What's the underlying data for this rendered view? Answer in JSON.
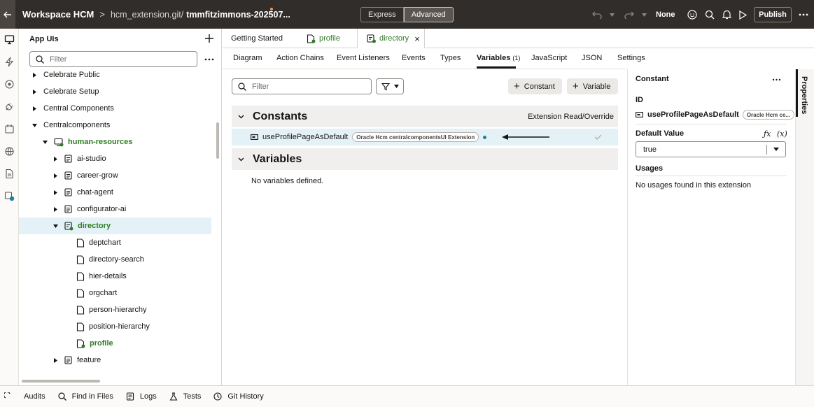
{
  "header": {
    "app_title": "Workspace HCM",
    "breadcrumb_sep": ">",
    "path": "hcm_extension.git/",
    "repo": "tmmfitzimmons-202507...",
    "modes": [
      "Express",
      "Advanced"
    ],
    "active_mode": "Advanced",
    "none_label": "None",
    "publish_label": "Publish"
  },
  "app_panel": {
    "title": "App UIs",
    "filter_placeholder": "Filter",
    "tree": [
      {
        "label": "Celebrate Public"
      },
      {
        "label": "Celebrate Setup"
      },
      {
        "label": "Central Components"
      },
      {
        "label": "Centralcomponents"
      },
      {
        "label": "human-resources"
      },
      {
        "label": "ai-studio"
      },
      {
        "label": "career-grow"
      },
      {
        "label": "chat-agent"
      },
      {
        "label": "configurator-ai"
      },
      {
        "label": "directory"
      },
      {
        "label": "deptchart"
      },
      {
        "label": "directory-search"
      },
      {
        "label": "hier-details"
      },
      {
        "label": "orgchart"
      },
      {
        "label": "person-hierarchy"
      },
      {
        "label": "position-hierarchy"
      },
      {
        "label": "profile"
      },
      {
        "label": "feature"
      }
    ]
  },
  "file_tabs": {
    "getting_started": "Getting Started",
    "profile": "profile",
    "directory": "directory",
    "close": "×"
  },
  "sub_tabs": {
    "diagram": "Diagram",
    "action_chains": "Action Chains",
    "event_listeners": "Event Listeners",
    "events": "Events",
    "types": "Types",
    "variables": "Variables",
    "variables_count": "(1)",
    "javascript": "JavaScript",
    "json": "JSON",
    "settings": "Settings"
  },
  "variables_view": {
    "filter_placeholder": "Filter",
    "add_constant": "Constant",
    "add_variable": "Variable",
    "constants_title": "Constants",
    "constants_mode": "Extension Read/Override",
    "constant_name": "useProfilePageAsDefault",
    "constant_badge": "Oracle Hcm centralcomponentsUI Extension",
    "variables_title": "Variables",
    "no_variables": "No variables defined."
  },
  "properties": {
    "title": "Constant",
    "id_label": "ID",
    "id_value": "useProfilePageAsDefault",
    "id_badge": "Oracle Hcm ce...",
    "default_label": "Default Value",
    "fx": "ƒx",
    "x_expr": "(x)",
    "default_value": "true",
    "usages_label": "Usages",
    "usages_text": "No usages found in this extension",
    "side_tab": "Properties"
  },
  "statusbar": {
    "audits": "Audits",
    "find": "Find in Files",
    "logs": "Logs",
    "tests": "Tests",
    "git": "Git History"
  },
  "colors": {
    "header_bg": "#312d2a",
    "selection_bg": "#e4f1f7",
    "green_text": "#2f7d23",
    "status_dot": "#227e9e"
  }
}
